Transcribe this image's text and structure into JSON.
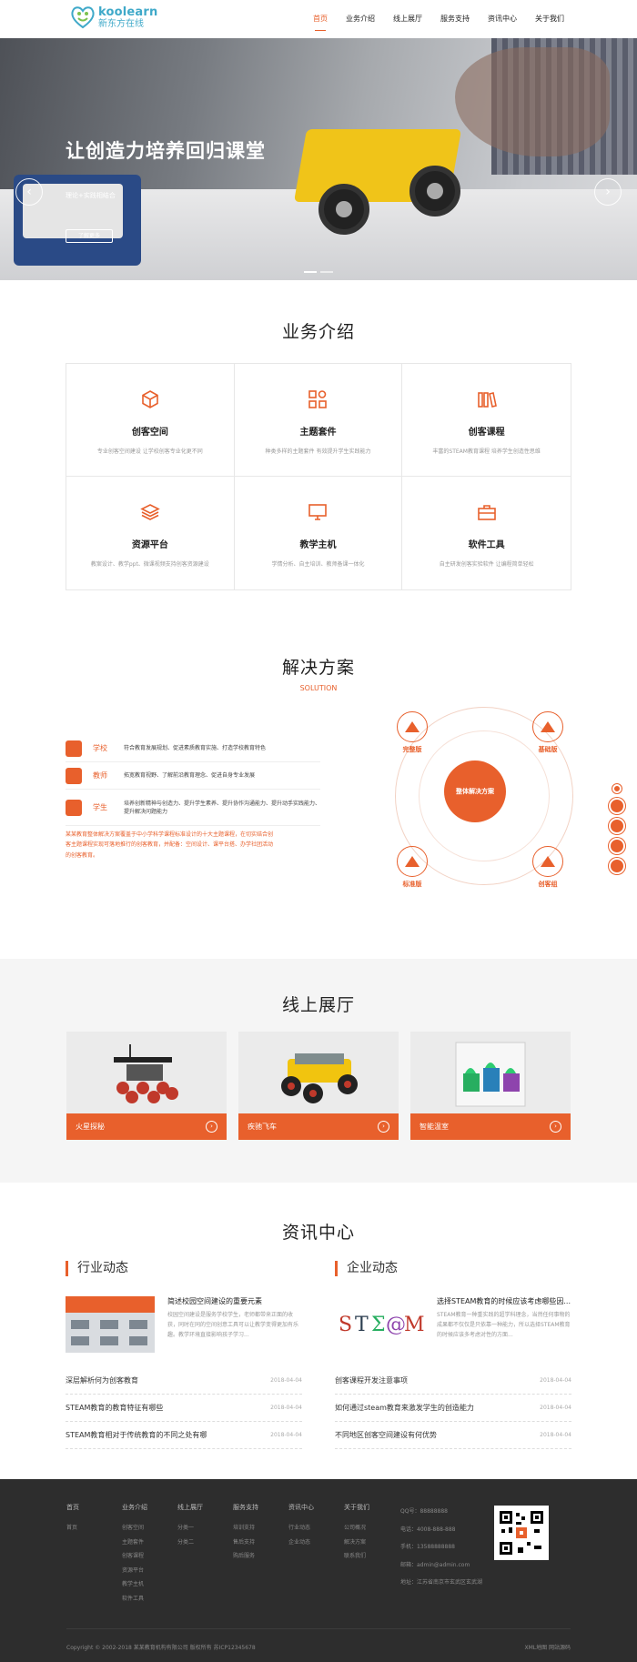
{
  "brand": {
    "name_en": "koolearn",
    "name_cn": "新东方在线"
  },
  "nav": [
    "首页",
    "业务介绍",
    "线上展厅",
    "服务支持",
    "资讯中心",
    "关于我们"
  ],
  "banner": {
    "title": "让创造力培养回归课堂",
    "subtitle": "理论+实践相结合",
    "button": "了解更多",
    "prev": "‹",
    "next": "›"
  },
  "business": {
    "title": "业务介绍",
    "items": [
      {
        "title": "创客空间",
        "desc": "专业创客空间建设 让学校创客专业化更不同",
        "icon": "cube-icon"
      },
      {
        "title": "主题套件",
        "desc": "种类多样的主题套件 有效提升学生实践能力",
        "icon": "grid-icon"
      },
      {
        "title": "创客课程",
        "desc": "丰富的STEAM教育课程 培养学生创造性思维",
        "icon": "books-icon"
      },
      {
        "title": "资源平台",
        "desc": "教案设计、教学ppt、微课视频支持创客资源建设",
        "icon": "layers-icon"
      },
      {
        "title": "教学主机",
        "desc": "学情分析、自主培训、教师备课一体化",
        "icon": "monitor-icon"
      },
      {
        "title": "软件工具",
        "desc": "自主研发创客实验软件 让编程简单轻松",
        "icon": "toolbox-icon"
      }
    ]
  },
  "solution": {
    "title": "解决方案",
    "subtitle": "SOLUTION",
    "rows": [
      {
        "label": "学校",
        "desc": "符合教育发展规划、促进素质教育实施、打造学校教育特色",
        "icon": "school-icon"
      },
      {
        "label": "教师",
        "desc": "拓宽教育视野、了解前沿教育理念、促进自身专业发展",
        "icon": "teacher-icon"
      },
      {
        "label": "学生",
        "desc": "培养创新精神与创造力、提升学生素养、提升协作沟通能力、提升动手实践能力、提升解决问题能力",
        "icon": "student-icon"
      }
    ],
    "note": "某某教育整体解决方案覆盖于中小学科学课程标准设计的十大主题课程，在切实结合创客主题课程实现可落地推行的创客教育，并配备：空间设计、课平台搭、办学社团活动的创客教育。",
    "core": "整体解决方案",
    "nodes": [
      "完整版",
      "基础版",
      "标准版",
      "创客组"
    ]
  },
  "exhibition": {
    "title": "线上展厅",
    "items": [
      {
        "label": "火星探秘"
      },
      {
        "label": "疾驰飞车"
      },
      {
        "label": "智能温室"
      }
    ]
  },
  "news": {
    "title": "资讯中心",
    "industry": {
      "heading": "行业动态",
      "feature": {
        "title": "简述校园空间建设的重要元素",
        "body": "校园空间建设是服务学校学生，老师都带来正面的收获，同时在同的空间创意工具可以让教学变得更加有乐趣。教学环境直接影响孩子学习..."
      },
      "list": [
        {
          "title": "深层解析何为创客教育",
          "date": "2018-04-04"
        },
        {
          "title": "STEAM教育的教育特征有哪些",
          "date": "2018-04-04"
        },
        {
          "title": "STEAM教育相对于传统教育的不同之处有哪",
          "date": "2018-04-04"
        }
      ]
    },
    "company": {
      "heading": "企业动态",
      "feature": {
        "title": "选择STEAM教育的时候应该考虑哪些因...",
        "body": "STEAM教育一种重实践的超学科理念，当然任何事物的成果都不仅仅是只依靠一种能力，所以选择STEAM教育的时候应该多考虑对性的方面..."
      },
      "list": [
        {
          "title": "创客课程开发注意事项",
          "date": "2018-04-04"
        },
        {
          "title": "如何通过steam教育来激发学生的创造能力",
          "date": "2018-04-04"
        },
        {
          "title": "不同地区创客空间建设有何优势",
          "date": "2018-04-04"
        }
      ]
    }
  },
  "footer": {
    "cols": [
      {
        "head": "首页",
        "links": [
          "首页"
        ]
      },
      {
        "head": "业务介绍",
        "links": [
          "创客空间",
          "主题套件",
          "创客课程",
          "资源平台",
          "教学主机",
          "软件工具"
        ]
      },
      {
        "head": "线上展厅",
        "links": [
          "分类一",
          "分类二"
        ]
      },
      {
        "head": "服务支持",
        "links": [
          "培训支持",
          "售后支持",
          "购后服务"
        ]
      },
      {
        "head": "资讯中心",
        "links": [
          "行业动态",
          "企业动态"
        ]
      },
      {
        "head": "关于我们",
        "links": [
          "公司概况",
          "解决方案",
          "联系我们"
        ]
      }
    ],
    "contact": [
      "QQ号：88888888",
      "电话：4008-888-888",
      "手机：13588888888",
      "邮箱：admin@admin.com",
      "地址：江苏省南京市玄武区玄武湖"
    ],
    "copyright": "Copyright © 2002-2018 某某教育机构有限公司 版权所有 苏ICP12345678",
    "links": "XML地图 网站源码"
  },
  "colors": {
    "accent": "#e8602c",
    "footer": "#2d2d2d"
  }
}
